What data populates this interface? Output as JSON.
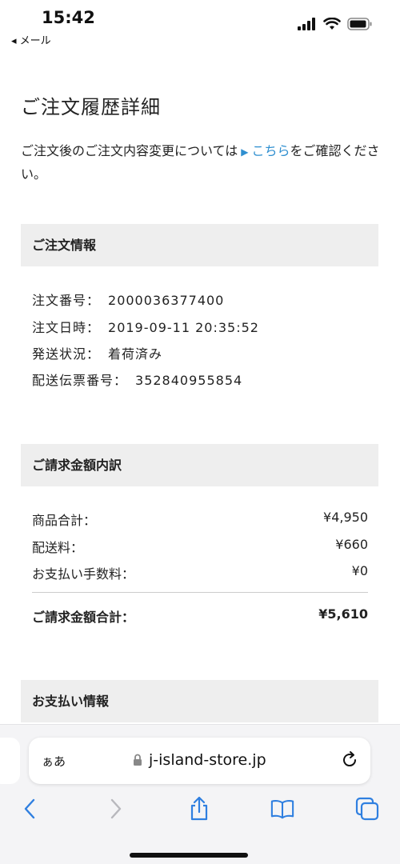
{
  "status_bar": {
    "time": "15:42",
    "back_app": "◂ メール"
  },
  "page": {
    "title": "ご注文履歴詳細",
    "notice_before": "ご注文後のご注文内容変更については",
    "notice_arrow": "▶",
    "notice_link": "こちら",
    "notice_after": "をご確認ください。"
  },
  "order_info": {
    "heading": "ご注文情報",
    "rows": [
      {
        "label": "注文番号：",
        "value": "2000036377400"
      },
      {
        "label": "注文日時：",
        "value": "2019-09-11 20:35:52"
      },
      {
        "label": "発送状況：",
        "value": "着荷済み"
      },
      {
        "label": "配送伝票番号：",
        "value": "352840955854"
      }
    ]
  },
  "billing": {
    "heading": "ご請求金額内訳",
    "rows": [
      {
        "label": "商品合計：",
        "value": "¥4,950"
      },
      {
        "label": "配送料：",
        "value": "¥660"
      },
      {
        "label": "お支払い手数料：",
        "value": "¥0"
      }
    ],
    "total_label": "ご請求金額合計：",
    "total_value": "¥5,610"
  },
  "payment": {
    "heading": "お支払い情報"
  },
  "browser": {
    "text_size_button": "ぁあ",
    "url": "j-island-store.jp"
  },
  "icons": {
    "signal": "signal-icon",
    "wifi": "wifi-icon",
    "battery": "battery-icon",
    "lock": "lock-icon",
    "reload": "reload-icon",
    "back": "back-arrow-icon",
    "forward": "forward-arrow-icon",
    "share": "share-icon",
    "bookmarks": "bookmarks-icon",
    "tabs": "tabs-icon"
  },
  "colors": {
    "link": "#2f8fd0",
    "section_bg": "#eeeeee",
    "toolbar_accent": "#2f7fe0"
  }
}
